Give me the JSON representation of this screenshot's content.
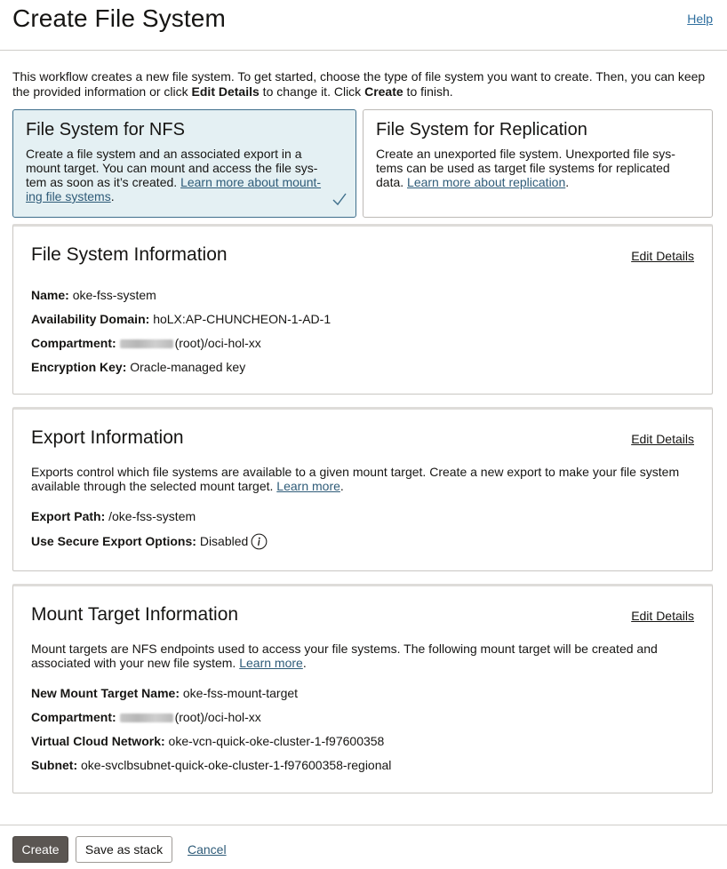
{
  "header": {
    "title": "Create File System",
    "help": "Help"
  },
  "intro": {
    "part1": "This workflow creates a new file system. To get started, choose the type of file system you want to create. Then, you can keep the provided information or click ",
    "bold1": "Edit Details",
    "part2": " to change it. Click ",
    "bold2": "Create",
    "part3": " to finish."
  },
  "types": {
    "nfs": {
      "title": "File System for NFS",
      "desc_line1": "Create a file system and an associated export in a",
      "desc_line2": "mount target. You can mount and access the file sys-",
      "desc_line3": "tem as soon as it’s created. ",
      "link_a": "Learn more about mount-",
      "link_b": "ing file systems",
      "tail": "."
    },
    "replication": {
      "title": "File System for Replication",
      "desc_line1": "Create an unexported file system. Unexported file sys-",
      "desc_line2": "tems can be used as target file systems for replicated",
      "desc_line3": "data. ",
      "link": "Learn more about replication",
      "tail": "."
    }
  },
  "fs_info": {
    "title": "File System Information",
    "edit": "Edit Details",
    "name_label": "Name:",
    "name_value": "oke-fss-system",
    "ad_label": "Availability Domain:",
    "ad_value": "hoLX:AP-CHUNCHEON-1-AD-1",
    "compartment_label": "Compartment:",
    "compartment_value": "(root)/oci-hol-xx",
    "enc_label": "Encryption Key:",
    "enc_value": "Oracle-managed key"
  },
  "export_info": {
    "title": "Export Information",
    "edit": "Edit Details",
    "desc_line1": "Exports control which file systems are available to a given mount target. Create a new export to make your file system",
    "desc_line2": "available through the selected mount target. ",
    "learn_more": "Learn more",
    "tail": ".",
    "path_label": "Export Path:",
    "path_value": "/oke-fss-system",
    "secure_label": "Use Secure Export Options:",
    "secure_value": "Disabled"
  },
  "mount_info": {
    "title": "Mount Target Information",
    "edit": "Edit Details",
    "desc_line1": "Mount targets are NFS endpoints used to access your file systems. The following mount target will be created and",
    "desc_line2": "associated with your new file system. ",
    "learn_more": "Learn more",
    "tail": ".",
    "name_label": "New Mount Target Name:",
    "name_value": "oke-fss-mount-target",
    "compartment_label": "Compartment:",
    "compartment_value": "(root)/oci-hol-xx",
    "vcn_label": "Virtual Cloud Network:",
    "vcn_value": "oke-vcn-quick-oke-cluster-1-f97600358",
    "subnet_label": "Subnet:",
    "subnet_value": "oke-svclbsubnet-quick-oke-cluster-1-f97600358-regional"
  },
  "footer": {
    "create": "Create",
    "save_stack": "Save as stack",
    "cancel": "Cancel"
  }
}
